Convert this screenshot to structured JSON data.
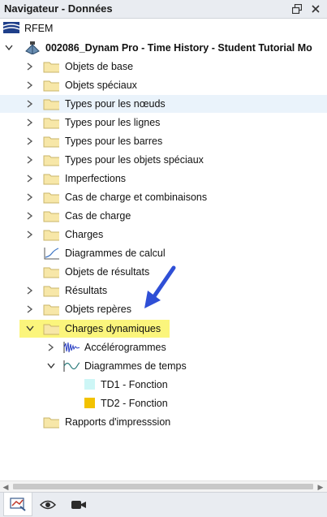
{
  "panel": {
    "title": "Navigateur - Données"
  },
  "tree": {
    "root": "RFEM",
    "project": "002086_Dynam Pro - Time History - Student Tutorial Mo",
    "items": [
      "Objets de base",
      "Objets spéciaux",
      "Types pour les nœuds",
      "Types pour les lignes",
      "Types pour les barres",
      "Types pour les objets spéciaux",
      "Imperfections",
      "Cas de charge et combinaisons",
      "Cas de charge",
      "Charges",
      "Diagrammes de calcul",
      "Objets de résultats",
      "Résultats",
      "Objets repères",
      "Charges dynamiques"
    ],
    "dynamic_children": {
      "accelerograms": "Accélérogrammes",
      "time_diagrams": "Diagrammes de temps",
      "td1": "TD1 - Fonction",
      "td2": "TD2 - Fonction"
    },
    "reports": "Rapports d'impresssion"
  },
  "colors": {
    "folder": "#f7e7a8",
    "highlight": "#fbf57c",
    "selection": "#eaf3fb",
    "td1": "#cdf6f6",
    "td2": "#f2c200",
    "arrow": "#2f4fd6"
  }
}
